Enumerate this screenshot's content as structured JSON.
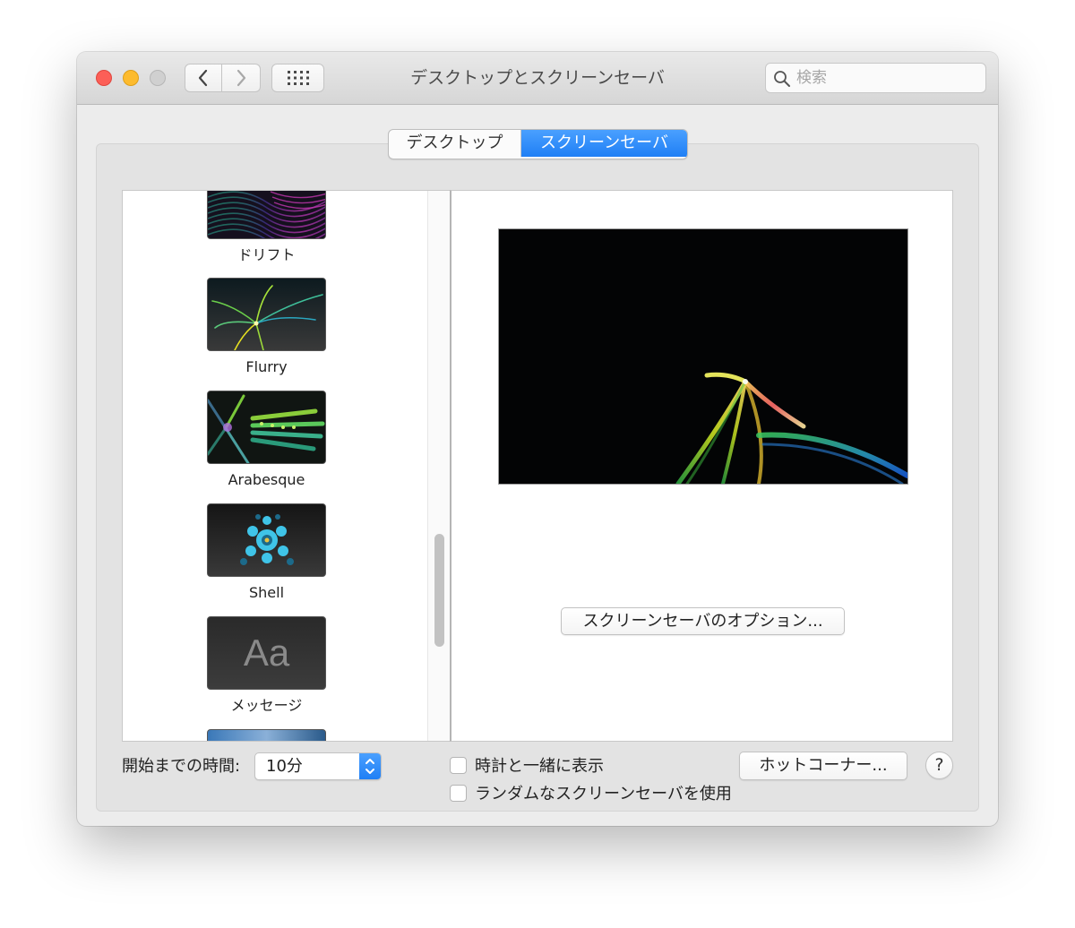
{
  "window": {
    "title": "デスクトップとスクリーンセーバ"
  },
  "toolbar": {
    "back_icon": "chevron-left-icon",
    "forward_icon": "chevron-right-icon",
    "grid_icon": "grid-icon"
  },
  "search": {
    "placeholder": "検索",
    "value": ""
  },
  "tabs": [
    {
      "label": "デスクトップ",
      "selected": false
    },
    {
      "label": "スクリーンセーバ",
      "selected": true
    }
  ],
  "screensavers": [
    {
      "label": "ドリフト",
      "icon": "drift-thumbnail"
    },
    {
      "label": "Flurry",
      "icon": "flurry-thumbnail",
      "selected": true
    },
    {
      "label": "Arabesque",
      "icon": "arabesque-thumbnail"
    },
    {
      "label": "Shell",
      "icon": "shell-thumbnail"
    },
    {
      "label": "メッセージ",
      "icon": "message-thumbnail",
      "glyph": "Aa"
    }
  ],
  "preview": {
    "options_button": "スクリーンセーバのオプション..."
  },
  "footer": {
    "start_label": "開始までの時間:",
    "start_value": "10分",
    "show_clock_label": "時計と一緒に表示",
    "show_clock_checked": false,
    "random_label": "ランダムなスクリーンセーバを使用",
    "random_checked": false,
    "hot_corners_button": "ホットコーナー...",
    "help_button": "?"
  },
  "colors": {
    "accent": "#1f7ff5",
    "close": "#fc5f57",
    "minimize": "#fdbb2e",
    "zoom_disabled": "#d0d0d0"
  }
}
